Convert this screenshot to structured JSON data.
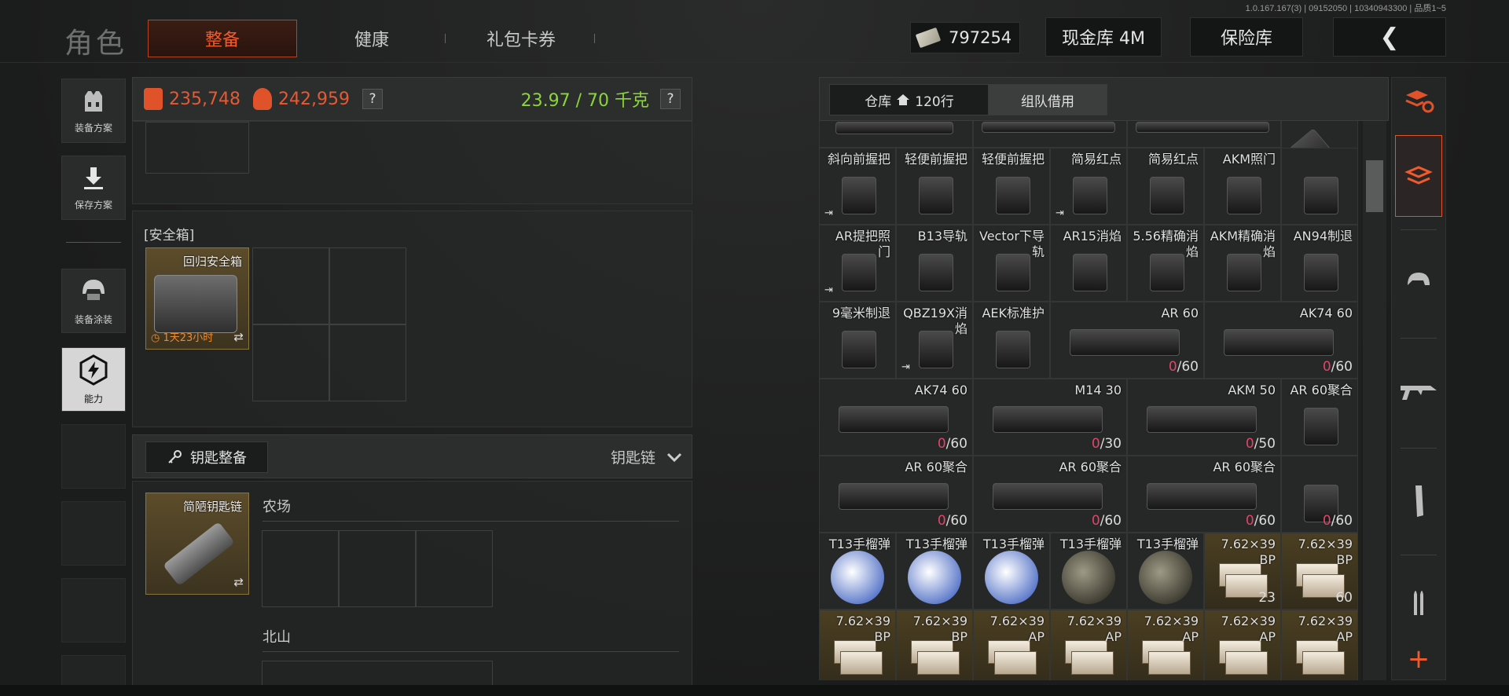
{
  "version": "1.0.167.167(3) | 09152050 | 10340943300 | 品质1~5",
  "header": {
    "title": "角色",
    "tabs": [
      "整备",
      "健康",
      "礼包卡券"
    ],
    "money": "797254",
    "cash_vault": "现金库 4M",
    "insurance": "保险库",
    "back": "❮"
  },
  "sidebar": {
    "items": [
      {
        "label": "装备方案",
        "icon": "vest-icon"
      },
      {
        "label": "保存方案",
        "icon": "download-icon"
      },
      {
        "label": "装备涂装",
        "icon": "helmet-icon"
      },
      {
        "label": "能力",
        "icon": "ability-icon"
      }
    ]
  },
  "stats": {
    "value_equipped": "235,748",
    "value_backpack": "242,959",
    "help": "?",
    "weight": "23.97 / 70 千克"
  },
  "safebox": {
    "label": "安全箱",
    "item_name": "回归安全箱",
    "timer": "1天23小时",
    "swap": "⇄"
  },
  "keys": {
    "button": "钥匙整备",
    "chain_label": "钥匙链",
    "item_name": "简陋钥匙链",
    "locations": [
      "农场",
      "北山"
    ]
  },
  "warehouse": {
    "tab_warehouse": "仓库",
    "rows": "120行",
    "tab_team": "组队借用",
    "rows_data": [
      [
        {
          "name": "斜向前握把",
          "exit": true
        },
        {
          "name": "轻便前握把"
        },
        {
          "name": "轻便前握把"
        },
        {
          "name": "简易红点",
          "exit": true
        },
        {
          "name": "简易红点"
        },
        {
          "name": "AKM照门"
        },
        {
          "name": ""
        }
      ],
      [
        {
          "name": "AR提把照门",
          "exit": true
        },
        {
          "name": "B13导轨"
        },
        {
          "name": "Vector下导轨"
        },
        {
          "name": "AR15消焰"
        },
        {
          "name": "5.56精确消焰"
        },
        {
          "name": "AKM精确消焰"
        },
        {
          "name": "AN94制退"
        }
      ],
      [
        {
          "name": "9毫米制退"
        },
        {
          "name": "QBZ19X消焰",
          "exit": true
        },
        {
          "name": "AEK标准护"
        },
        {
          "name": "AR 60",
          "count_red": "0",
          "count": "/60",
          "wide": true
        },
        {
          "name": "AK74 60",
          "count_red": "0",
          "count": "/60",
          "wide": true
        }
      ],
      [
        {
          "name": "AK74 60",
          "count_red": "0",
          "count": "/60",
          "wide": true
        },
        {
          "name": "M14 30",
          "count_red": "0",
          "count": "/30",
          "wide": true
        },
        {
          "name": "AKM 50",
          "count_red": "0",
          "count": "/50",
          "wide": true
        },
        {
          "name": "AR 60聚合"
        }
      ],
      [
        {
          "name": "AR 60聚合",
          "count_red": "0",
          "count": "/60",
          "wide": true
        },
        {
          "name": "AR 60聚合",
          "count_red": "0",
          "count": "/60",
          "wide": true
        },
        {
          "name": "AR 60聚合",
          "count_red": "0",
          "count": "/60",
          "wide": true
        },
        {
          "name": "",
          "count_red": "0",
          "count": "/60"
        }
      ],
      [
        {
          "name": "T13手榴弹"
        },
        {
          "name": "T13手榴弹"
        },
        {
          "name": "T13手榴弹"
        },
        {
          "name": "T13手榴弹"
        },
        {
          "name": "T13手榴弹"
        },
        {
          "name": "7.62×39 BP",
          "count": "23",
          "gold": true
        },
        {
          "name": "7.62×39 BP",
          "count": "60",
          "gold": true
        }
      ],
      [
        {
          "name": "7.62×39 BP",
          "gold": true
        },
        {
          "name": "7.62×39 BP",
          "gold": true
        },
        {
          "name": "7.62×39 AP",
          "gold": true
        },
        {
          "name": "7.62×39 AP",
          "gold": true
        },
        {
          "name": "7.62×39 AP",
          "gold": true
        },
        {
          "name": "7.62×39 AP",
          "gold": true
        },
        {
          "name": "7.62×39 AP",
          "gold": true
        }
      ]
    ]
  },
  "rail": {
    "icons": [
      "stack-refresh-icon",
      "all-items-icon",
      "helmet-filter-icon",
      "rifle-filter-icon",
      "magazine-filter-icon",
      "ammo-filter-icon",
      "add-icon"
    ]
  },
  "colors": {
    "accent": "#e0532a",
    "weight": "#8bd63a",
    "gold_slot": "#4b3f22"
  }
}
